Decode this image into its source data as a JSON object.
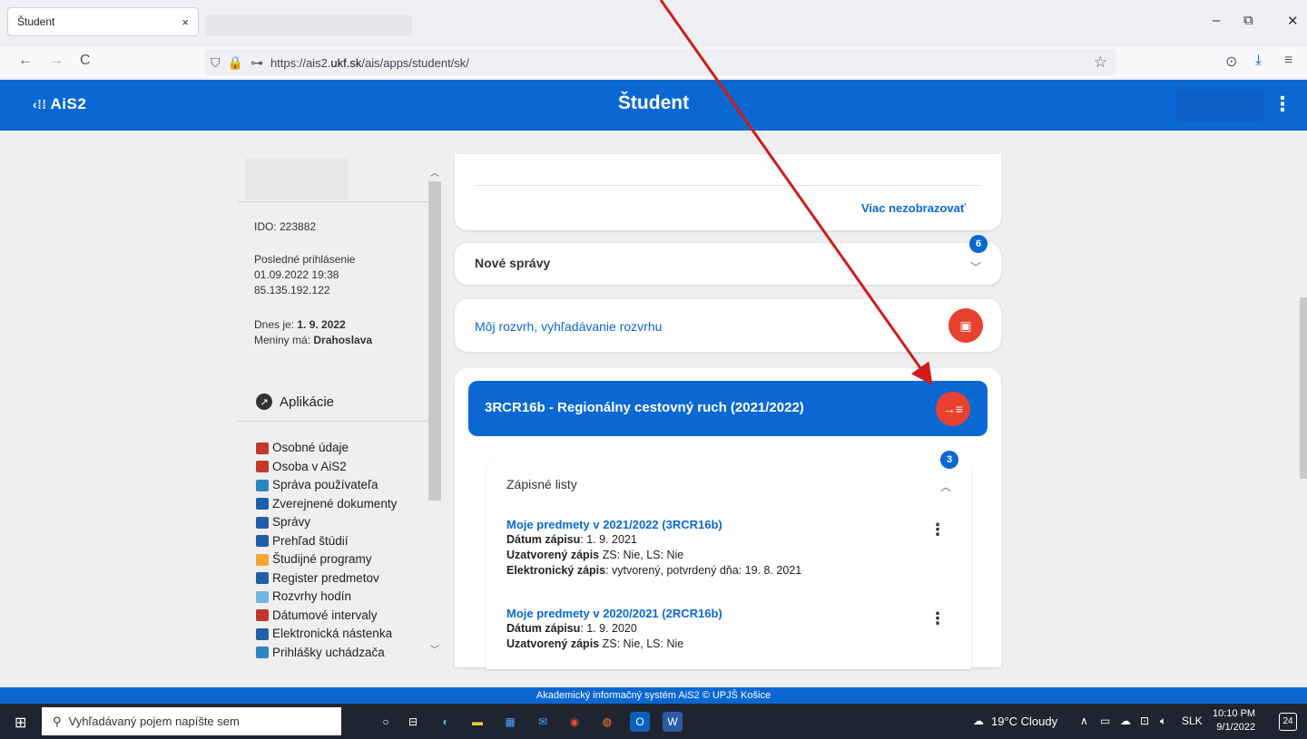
{
  "browser": {
    "tab_title": "Študent",
    "tab_close": "×",
    "url_prefix": "https://ais2.",
    "url_domain": "ukf.sk",
    "url_path": "/ais/apps/student/sk/",
    "minimize": "–",
    "restore": "⧉",
    "close": "✕",
    "back": "←",
    "forward": "→",
    "reload": "C",
    "shield": "⛉",
    "lock": "🔒",
    "perm": "⊶",
    "bookmark": "☆",
    "pocket": "⊙",
    "download": "⤓",
    "menu": "≡"
  },
  "app": {
    "logo_text": "AiS2",
    "title": "Študent"
  },
  "sidebar": {
    "ido": "IDO: 223882",
    "last_login_label": "Posledné prihlásenie",
    "last_login_date": "01.09.2022 19:38",
    "last_login_ip": "85.135.192.122",
    "today_label": "Dnes je: ",
    "today_value": "1. 9. 2022",
    "nameday_label": "Meniny má: ",
    "nameday_value": "Drahoslava",
    "apps_title": "Aplikácie",
    "apps": [
      {
        "label": "Osobné údaje",
        "color": "#c0392b"
      },
      {
        "label": "Osoba v AiS2",
        "color": "#c0392b"
      },
      {
        "label": "Správa používateľa",
        "color": "#2e86c1"
      },
      {
        "label": "Zverejnené dokumenty",
        "color": "#1f5fa8"
      },
      {
        "label": "Správy",
        "color": "#1f5fa8"
      },
      {
        "label": "Prehľad štúdií",
        "color": "#1f5fa8"
      },
      {
        "label": "Študijné programy",
        "color": "#f0a830"
      },
      {
        "label": "Register predmetov",
        "color": "#1f5fa8"
      },
      {
        "label": "Rozvrhy hodín",
        "color": "#6fb6e0"
      },
      {
        "label": "Dátumové intervaly",
        "color": "#c0392b"
      },
      {
        "label": "Elektronická nástenka",
        "color": "#1f5fa8"
      },
      {
        "label": "Prihlášky uchádzača",
        "color": "#2e86c1"
      }
    ]
  },
  "cards": {
    "top_link": "Viac nezobrazovať",
    "messages_title": "Nové správy",
    "messages_badge": "6",
    "schedule_link": "Môj rozvrh, vyhľadávanie rozvrhu",
    "study_title": "3RCR16b - Regionálny cestovný ruch (2021/2022)",
    "enrollment_title": "Zápisné listy",
    "enrollment_badge": "3",
    "entries": [
      {
        "title": "Moje predmety v 2021/2022 (3RCR16b)",
        "date_label": "Dátum zápisu",
        "date_value": ": 1. 9. 2021",
        "closed_label": "Uzatvorený zápis",
        "closed_value": "  ZS: Nie,  LS: Nie",
        "el_label": "Elektronický zápis",
        "el_value": ": vytvorený, potvrdený dňa: 19. 8. 2021"
      },
      {
        "title": "Moje predmety v 2020/2021 (2RCR16b)",
        "date_label": "Dátum zápisu",
        "date_value": ": 1. 9. 2020",
        "closed_label": "Uzatvorený zápis",
        "closed_value": "  ZS: Nie,  LS: Nie"
      }
    ]
  },
  "footer": "Akademický informačný systém AiS2 © UPJŠ Košice",
  "taskbar": {
    "search_placeholder": "Vyhľadávaný pojem napíšte sem",
    "weather": "19°C  Cloudy",
    "lang": "SLK",
    "time": "10:10 PM",
    "date": "9/1/2022",
    "notif_count": "24"
  }
}
